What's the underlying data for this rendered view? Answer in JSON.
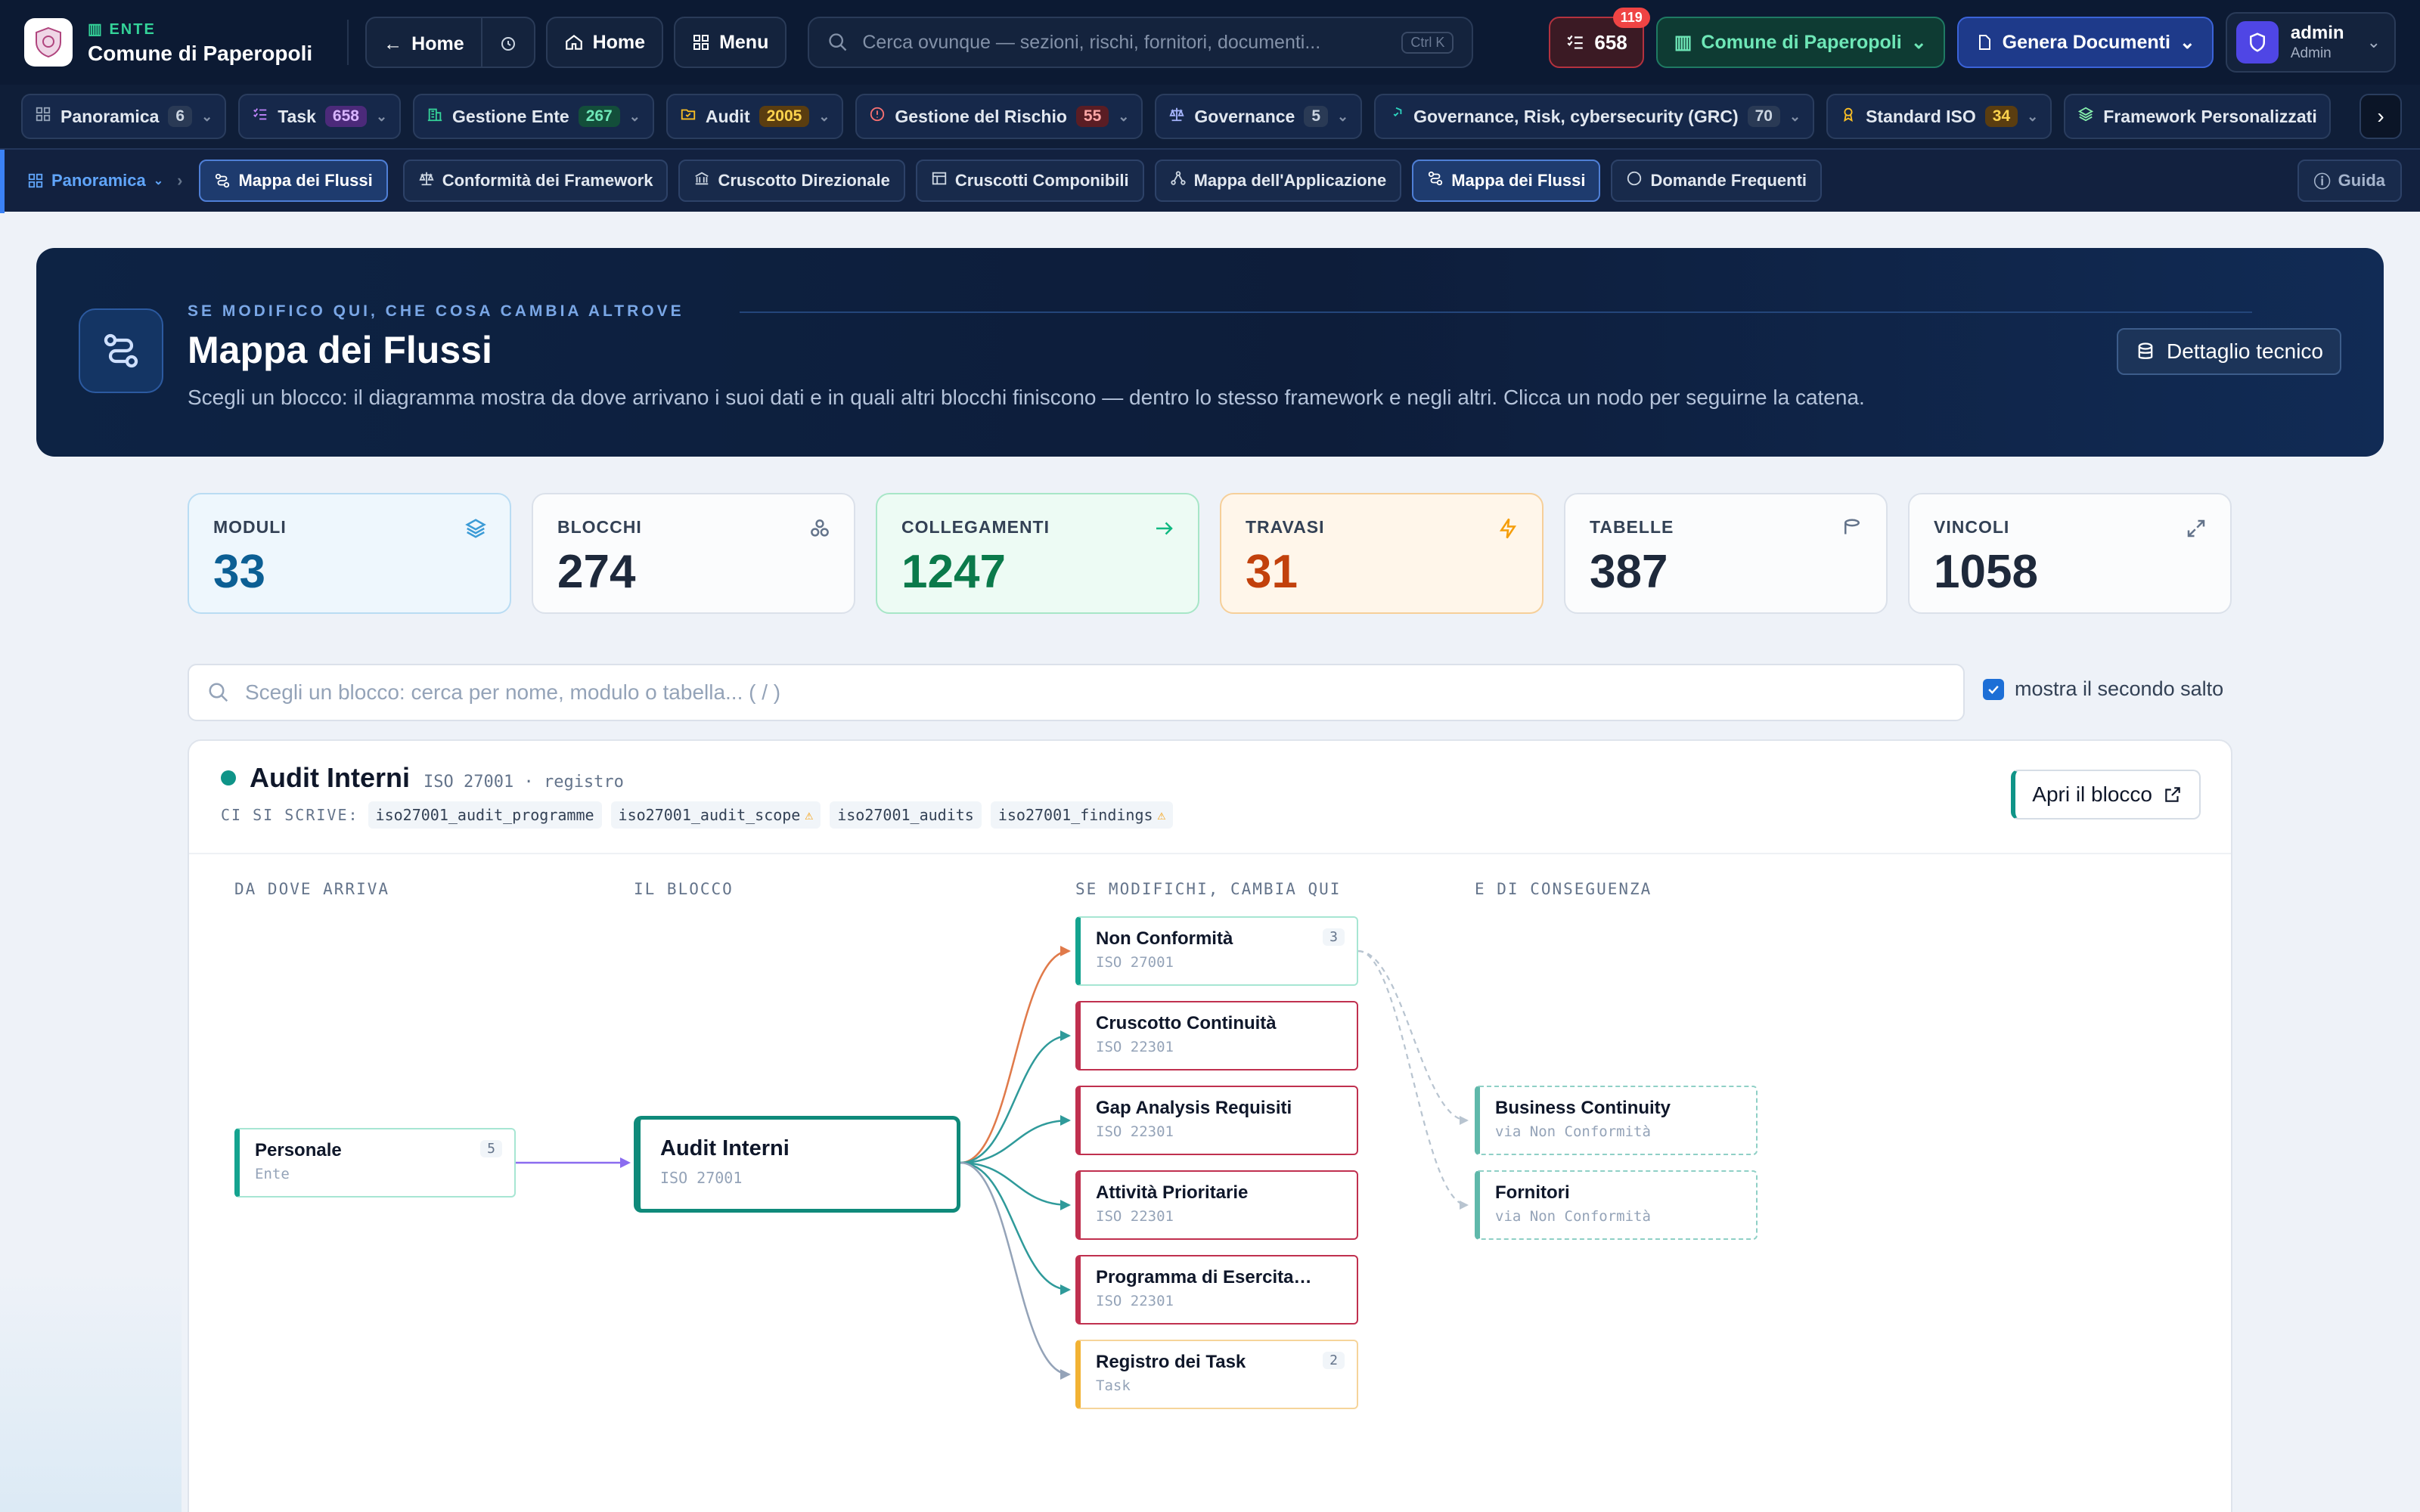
{
  "topbar": {
    "ente_kicker": "ENTE",
    "ente_name": "Comune di Paperopoli",
    "back_label": "Home",
    "home_label": "Home",
    "menu_label": "Menu",
    "search_placeholder": "Cerca ovunque — sezioni, rischi, fornitori, documenti...",
    "search_shortcut": "Ctrl K",
    "task_count": "658",
    "task_badge": "119",
    "ente_selector": "Comune di Paperopoli",
    "generate_label": "Genera Documenti",
    "user_name": "admin",
    "user_role": "Admin"
  },
  "modules": [
    {
      "label": "Panoramica",
      "count": "6",
      "icon": "grid-icon",
      "color": "#94a3b8",
      "bg": "#2a3a55",
      "fg": "#cbd5e1"
    },
    {
      "label": "Task",
      "count": "658",
      "icon": "checklist-icon",
      "color": "#c084fc",
      "bg": "#4c2a7a",
      "fg": "#d8b4fe"
    },
    {
      "label": "Gestione Ente",
      "count": "267",
      "icon": "building-icon",
      "color": "#34d399",
      "bg": "#134e3a",
      "fg": "#6ee7b7"
    },
    {
      "label": "Audit",
      "count": "2005",
      "icon": "folder-check-icon",
      "color": "#fbbf24",
      "bg": "#5a3d10",
      "fg": "#fcd34d"
    },
    {
      "label": "Gestione del Rischio",
      "count": "55",
      "icon": "alert-circle-icon",
      "color": "#f87171",
      "bg": "#5a1d24",
      "fg": "#fca5a5"
    },
    {
      "label": "Governance",
      "count": "5",
      "icon": "scale-icon",
      "color": "#a5b4fc",
      "bg": "#2a3a55",
      "fg": "#cbd5e1"
    },
    {
      "label": "Governance, Risk, cybersecurity (GRC)",
      "count": "70",
      "icon": "shield-check-icon",
      "color": "#2dd4bf",
      "bg": "#2a3a55",
      "fg": "#cbd5e1"
    },
    {
      "label": "Standard ISO",
      "count": "34",
      "icon": "award-icon",
      "color": "#fbbf24",
      "bg": "#5a3d10",
      "fg": "#fcd34d"
    },
    {
      "label": "Framework Personalizzati",
      "count": "",
      "icon": "layers-icon",
      "color": "#86efac",
      "bg": "#2a3a55",
      "fg": "#cbd5e1"
    }
  ],
  "subnav": {
    "crumb": "Panoramica",
    "current": "Mappa dei Flussi",
    "tabs": [
      {
        "label": "Conformità dei Framework",
        "icon": "scale-icon"
      },
      {
        "label": "Cruscotto Direzionale",
        "icon": "bank-icon"
      },
      {
        "label": "Cruscotti Componibili",
        "icon": "layout-icon"
      },
      {
        "label": "Mappa dell'Applicazione",
        "icon": "network-icon"
      },
      {
        "label": "Mappa dei Flussi",
        "icon": "flow-icon"
      },
      {
        "label": "Domande Frequenti",
        "icon": "help-circle-icon"
      }
    ],
    "guide_label": "Guida"
  },
  "hero": {
    "kicker": "SE MODIFICO QUI, CHE COSA CAMBIA ALTROVE",
    "title": "Mappa dei Flussi",
    "description": "Scegli un blocco: il diagramma mostra da dove arrivano i suoi dati e in quali altri blocchi finiscono — dentro lo stesso framework e negli altri. Clicca un nodo per seguirne la catena.",
    "tech_button": "Dettaglio tecnico"
  },
  "stats": [
    {
      "label": "MODULI",
      "value": "33",
      "icon": "layers-icon",
      "bg": "#eef7fd",
      "border": "#b9dcf3",
      "color": "#0c5f94",
      "icon_color": "#3b9bd6"
    },
    {
      "label": "BLOCCHI",
      "value": "274",
      "icon": "blocks-icon",
      "bg": "#fbfcfd",
      "border": "#dbe1ea",
      "color": "#1e293b",
      "icon_color": "#64748b"
    },
    {
      "label": "COLLEGAMENTI",
      "value": "1247",
      "icon": "arrow-right-icon",
      "bg": "#edfbf4",
      "border": "#a7e6c7",
      "color": "#0b7a4b",
      "icon_color": "#10b981"
    },
    {
      "label": "TRAVASI",
      "value": "31",
      "icon": "bolt-icon",
      "bg": "#fff6ea",
      "border": "#f6cf99",
      "color": "#c2410c",
      "icon_color": "#f59e0b"
    },
    {
      "label": "TABELLE",
      "value": "387",
      "icon": "database-icon",
      "bg": "#fbfcfd",
      "border": "#dbe1ea",
      "color": "#1e293b",
      "icon_color": "#64748b"
    },
    {
      "label": "VINCOLI",
      "value": "1058",
      "icon": "expand-icon",
      "bg": "#fbfcfd",
      "border": "#dbe1ea",
      "color": "#1e293b",
      "icon_color": "#64748b"
    }
  ],
  "block_search": {
    "placeholder": "Scegli un blocco: cerca per nome, modulo o tabella...   ( / )",
    "second_hop_label": "mostra il secondo salto"
  },
  "panel": {
    "title": "Audit Interni",
    "framework": "ISO 27001",
    "kind": "registro",
    "writes_label": "CI SI SCRIVE:",
    "tables": [
      {
        "name": "iso27001_audit_programme",
        "warn": false
      },
      {
        "name": "iso27001_audit_scope",
        "warn": true
      },
      {
        "name": "iso27001_audits",
        "warn": false
      },
      {
        "name": "iso27001_findings",
        "warn": true
      }
    ],
    "open_button": "Apri il blocco",
    "columns": [
      "DA DOVE ARRIVA",
      "IL BLOCCO",
      "SE MODIFICHI, CAMBIA QUI",
      "E DI CONSEGUENZA"
    ],
    "source": {
      "title": "Personale",
      "sub": "Ente",
      "badge": "5"
    },
    "center": {
      "title": "Audit Interni",
      "sub": "ISO 27001"
    },
    "targets": [
      {
        "title": "Non Conformità",
        "sub": "ISO 27001",
        "badge": "3",
        "color": "#14a38f",
        "edge": "#e07a4a"
      },
      {
        "title": "Cruscotto Continuità",
        "sub": "ISO 22301",
        "badge": "",
        "color": "#c0304f",
        "edge": "#2f9a9a"
      },
      {
        "title": "Gap Analysis Requisiti",
        "sub": "ISO 22301",
        "badge": "",
        "color": "#c0304f",
        "edge": "#2f9a9a"
      },
      {
        "title": "Attività Prioritarie",
        "sub": "ISO 22301",
        "badge": "",
        "color": "#c0304f",
        "edge": "#2f9a9a"
      },
      {
        "title": "Programma di Esercitaz...",
        "sub": "ISO 22301",
        "badge": "",
        "color": "#c0304f",
        "edge": "#2f9a9a"
      },
      {
        "title": "Registro dei Task",
        "sub": "Task",
        "badge": "2",
        "color": "#f2b233",
        "edge": "#94a3b8"
      }
    ],
    "consequences": [
      {
        "title": "Business Continuity",
        "sub": "via Non Conformità"
      },
      {
        "title": "Fornitori",
        "sub": "via Non Conformità"
      }
    ]
  }
}
